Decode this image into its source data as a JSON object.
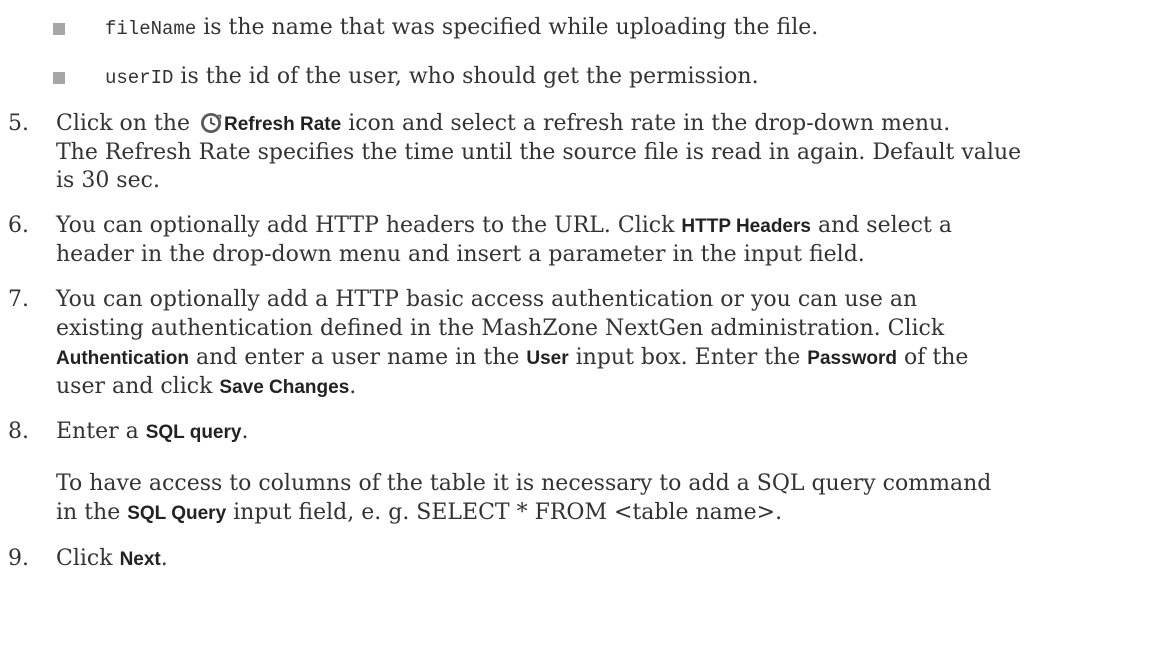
{
  "bullets": [
    {
      "code": "fileName",
      "text": " is the name that was specified while uploading the file."
    },
    {
      "code": "userID",
      "text": " is the id of the user, who should get the permission."
    }
  ],
  "steps": {
    "s5": {
      "number": "5.",
      "line1_a": "Click on the ",
      "line1_ui": "Refresh Rate",
      "line1_b": " icon and select a refresh rate in the drop-down menu.",
      "line2": "The Refresh Rate specifies the time until the source file is read in again. Default value",
      "line3": "is 30 sec."
    },
    "s6": {
      "number": "6.",
      "line1_a": "You can optionally add HTTP headers to the URL. Click ",
      "line1_ui": "HTTP Headers",
      "line1_b": " and select a",
      "line2": "header in the drop-down menu and insert a parameter in the input field."
    },
    "s7": {
      "number": "7.",
      "line1": "You can optionally add a HTTP basic access authentication or you can use an",
      "line2": "existing authentication defined in the MashZone NextGen administration. Click",
      "line3_ui1": "Authentication",
      "line3_a": " and enter a user name in the ",
      "line3_ui2": "User",
      "line3_b": " input box. Enter the ",
      "line3_ui3": "Password",
      "line3_c": " of the",
      "line4_a": "user and click ",
      "line4_ui": "Save Changes",
      "line4_b": "."
    },
    "s8": {
      "number": "8.",
      "line1_a": "Enter a ",
      "line1_ui": "SQL query",
      "line1_b": ".",
      "para_line1": "To have access to columns of the table it is necessary to add a SQL query command",
      "para_line2_a": "in the ",
      "para_line2_ui": "SQL Query",
      "para_line2_b": " input field, e. g. SELECT * FROM <table name>."
    },
    "s9": {
      "number": "9.",
      "line1_a": "Click ",
      "line1_ui": "Next",
      "line1_b": "."
    }
  },
  "icons": {
    "refresh": "refresh-rate-icon",
    "refresh_color": "#4a4a4a"
  }
}
